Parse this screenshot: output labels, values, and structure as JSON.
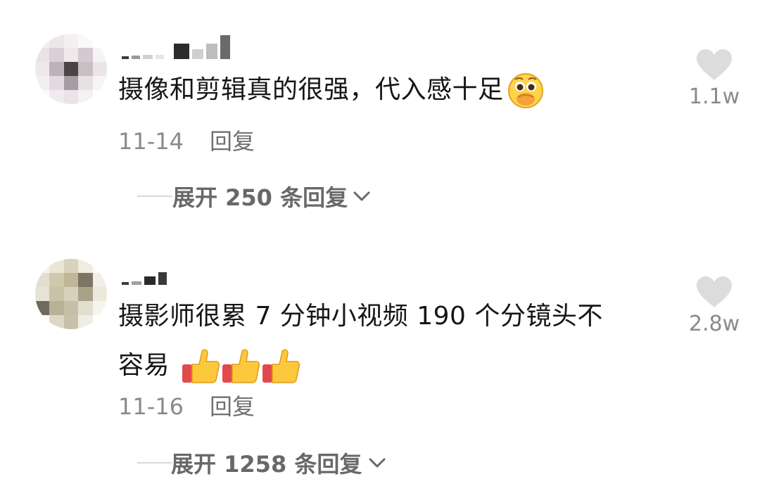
{
  "comments": [
    {
      "text": "摄像和剪辑真的很强，代入感十足",
      "emoji_icon": "hand-over-mouth-emoji-icon",
      "date": "11-14",
      "reply_label": "回复",
      "expand_label": "展开 250 条回复",
      "like_count": "1.1w"
    },
    {
      "text_line1": "摄影师很累 7 分钟小视频 190 个分镜头不",
      "text_line2": "容易",
      "emoji_icon": "thumbs-up-emoji-icon",
      "date": "11-16",
      "reply_label": "回复",
      "expand_label": "展开 1258 条回复",
      "like_count": "2.8w"
    }
  ],
  "colors": {
    "text": "#161616",
    "meta": "#8a8a8a",
    "expand": "#686868",
    "heart": "#dcdcdc"
  }
}
